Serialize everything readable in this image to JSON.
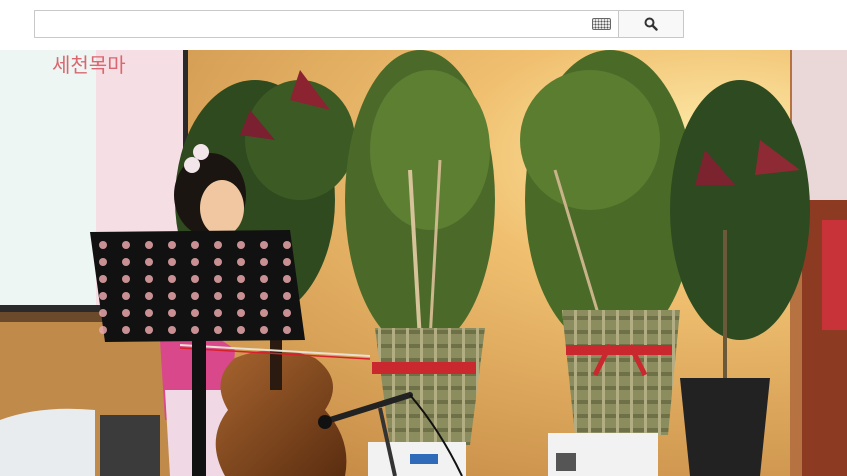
{
  "search": {
    "placeholder": "",
    "value": ""
  },
  "icons": {
    "keyboard": "keyboard-icon",
    "search": "search-icon"
  },
  "video": {
    "screen_text": "세천목마"
  },
  "colors": {
    "wall": "#d9a45c",
    "screen": "#eaf3f2",
    "bow": "#d8202a"
  }
}
